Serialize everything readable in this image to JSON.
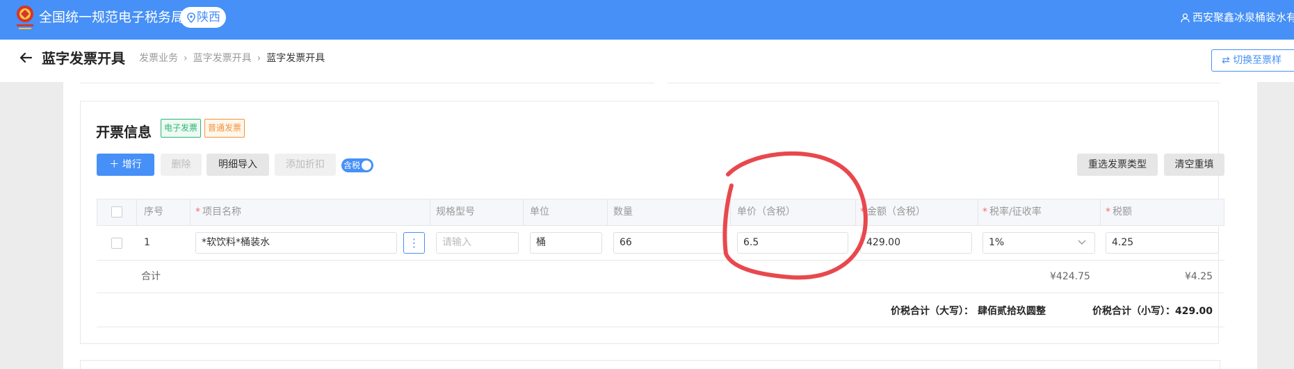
{
  "header": {
    "site_name": "全国统一规范电子税务局",
    "region": "陕西",
    "user": "西安聚鑫冰泉桶装水有限"
  },
  "subheader": {
    "page_title": "蓝字发票开具",
    "breadcrumb": [
      "发票业务",
      "蓝字发票开具",
      "蓝字发票开具"
    ],
    "switch_button": "切换至票样"
  },
  "section": {
    "title": "开票信息",
    "tags": [
      "电子发票",
      "普通发票"
    ]
  },
  "toolbar": {
    "add_row": "增行",
    "delete": "删除",
    "detail_import": "明细导入",
    "add_discount": "添加折扣",
    "tax_toggle": "含税",
    "tax_toggle_on": true,
    "reselect_type": "重选发票类型",
    "clear_refill": "清空重填"
  },
  "table": {
    "headers": {
      "index": "序号",
      "item_name": "项目名称",
      "spec": "规格型号",
      "unit": "单位",
      "quantity": "数量",
      "unit_price": "单价（含税）",
      "amount": "金额（含税）",
      "tax_rate": "税率/征收率",
      "tax_amount": "税额"
    },
    "rows": [
      {
        "index": "1",
        "item_name": "*软饮料*桶装水",
        "spec_placeholder": "请输入",
        "unit": "桶",
        "quantity": "66",
        "unit_price": "6.5",
        "amount": "429.00",
        "tax_rate": "1%",
        "tax_amount": "4.25"
      }
    ],
    "total": {
      "label": "合计",
      "amount": "¥424.75",
      "tax": "¥4.25"
    }
  },
  "summary": {
    "total_in_words_label": "价税合计（大写）：",
    "total_in_words": "肆佰贰拾玖圆整",
    "total_in_figures_label": "价税合计（小写）：",
    "total_in_figures": "429.00"
  },
  "colors": {
    "primary": "#4690f7",
    "required": "#f56c6c",
    "tag_electronic": "#2bb673",
    "tag_normal": "#f2933c",
    "annotation": "#e8484d"
  }
}
